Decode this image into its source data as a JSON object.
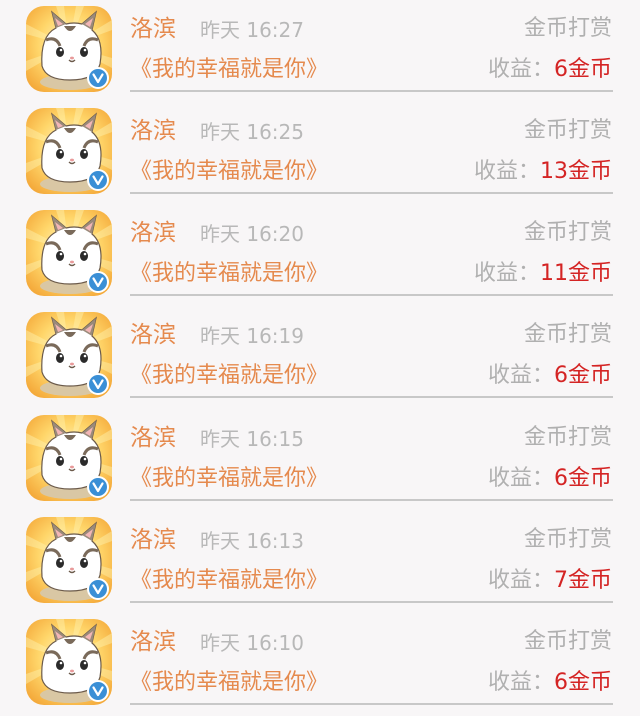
{
  "rows": [
    {
      "name": "洛滨",
      "time": "昨天 16:27",
      "type": "金币打赏",
      "book": "《我的幸福就是你》",
      "income_label": "收益：",
      "income_value": "6金币"
    },
    {
      "name": "洛滨",
      "time": "昨天 16:25",
      "type": "金币打赏",
      "book": "《我的幸福就是你》",
      "income_label": "收益：",
      "income_value": "13金币"
    },
    {
      "name": "洛滨",
      "time": "昨天 16:20",
      "type": "金币打赏",
      "book": "《我的幸福就是你》",
      "income_label": "收益：",
      "income_value": "11金币"
    },
    {
      "name": "洛滨",
      "time": "昨天 16:19",
      "type": "金币打赏",
      "book": "《我的幸福就是你》",
      "income_label": "收益：",
      "income_value": "6金币"
    },
    {
      "name": "洛滨",
      "time": "昨天 16:15",
      "type": "金币打赏",
      "book": "《我的幸福就是你》",
      "income_label": "收益：",
      "income_value": "6金币"
    },
    {
      "name": "洛滨",
      "time": "昨天 16:13",
      "type": "金币打赏",
      "book": "《我的幸福就是你》",
      "income_label": "收益：",
      "income_value": "7金币"
    },
    {
      "name": "洛滨",
      "time": "昨天 16:10",
      "type": "金币打赏",
      "book": "《我的幸福就是你》",
      "income_label": "收益：",
      "income_value": "6金币"
    }
  ],
  "avatar_icon": "cat-avatar-icon",
  "badge_icon": "verified-v-icon",
  "colors": {
    "name": "#e58a4e",
    "time": "#b8b8b8",
    "label": "#b0b0b0",
    "value": "#d42424",
    "badge": "#3a8fd6"
  }
}
